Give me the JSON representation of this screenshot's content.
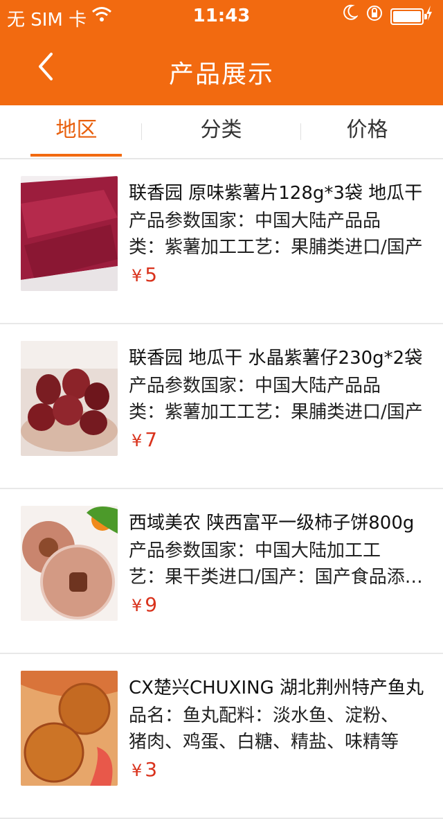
{
  "status_bar": {
    "carrier": "无 SIM 卡",
    "time": "11:43"
  },
  "nav": {
    "title": "产品展示"
  },
  "tabs": [
    {
      "label": "地区",
      "active": true
    },
    {
      "label": "分类",
      "active": false
    },
    {
      "label": "价格",
      "active": false
    }
  ],
  "products": [
    {
      "name": "联香园 原味紫薯片128g*3袋 地瓜干",
      "desc_line1": "产品参数国家：中国大陆产品品",
      "desc_line2": "类：紫薯加工工艺：果脯类进口/国产",
      "currency": "¥",
      "price": "5"
    },
    {
      "name": "联香园 地瓜干 水晶紫薯仔230g*2袋",
      "desc_line1": "产品参数国家：中国大陆产品品",
      "desc_line2": "类：紫薯加工工艺：果脯类进口/国产",
      "currency": "¥",
      "price": "7"
    },
    {
      "name": "西域美农 陕西富平一级柿子饼800g",
      "desc_line1": "产品参数国家：中国大陆加工工",
      "desc_line2": "艺：果干类进口/国产：国产食品添加剂",
      "currency": "¥",
      "price": "9"
    },
    {
      "name": "CX楚兴CHUXING 湖北荆州特产鱼丸",
      "desc_line1": "品名：鱼丸配料：淡水鱼、淀粉、",
      "desc_line2": "猪肉、鸡蛋、白糖、精盐、味精等",
      "currency": "¥",
      "price": "3"
    }
  ],
  "colors": {
    "brand": "#f26a10",
    "price": "#d9321c",
    "active_tab": "#e8600e"
  }
}
